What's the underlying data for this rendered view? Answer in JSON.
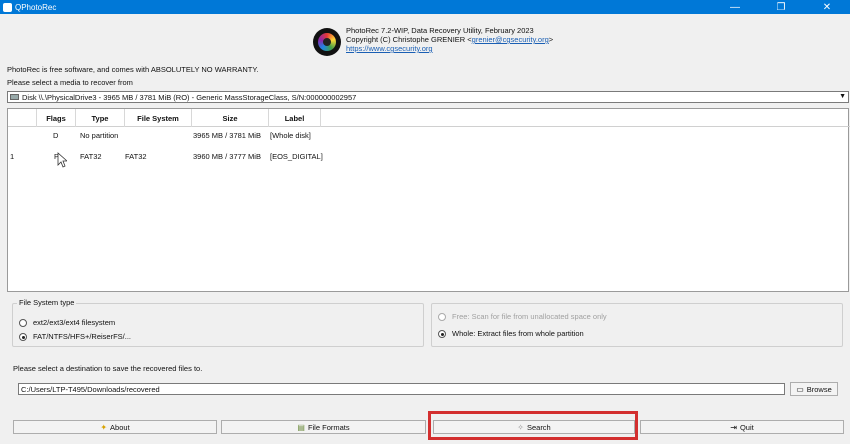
{
  "window": {
    "title": "QPhotoRec",
    "min_glyph": "—",
    "max_glyph": "❐",
    "close_glyph": "✕"
  },
  "header": {
    "line1": "PhotoRec 7.2-WIP, Data Recovery Utility, February 2023",
    "line2_prefix": "Copyright (C) Christophe GRENIER <",
    "email": "grenier@cgsecurity.org",
    "line2_suffix": ">",
    "url": "https://www.cgsecurity.org"
  },
  "warranty": "PhotoRec is free software, and comes with ABSOLUTELY NO WARRANTY.",
  "media_label": "Please select a media to recover from",
  "disk_selected": "Disk \\\\.\\PhysicalDrive3 - 3965 MB / 3781 MiB (RO) - Generic MassStorageClass, S/N:000000002957",
  "table": {
    "headers": [
      "",
      "Flags",
      "Type",
      "File System",
      "Size",
      "Label"
    ],
    "rows": [
      {
        "num": "",
        "flags": "D",
        "type": "No partition",
        "fs": "",
        "size": "3965 MB / 3781 MiB",
        "label": "[Whole disk]"
      },
      {
        "num": "1",
        "flags": "P",
        "type": "FAT32",
        "fs": "FAT32",
        "size": "3960 MB / 3777 MiB",
        "label": "[EOS_DIGITAL]"
      }
    ]
  },
  "fs_type": {
    "legend": "File System type",
    "option1": "ext2/ext3/ext4 filesystem",
    "option2": "FAT/NTFS/HFS+/ReiserFS/..."
  },
  "partition_scope": {
    "option1": "Free: Scan for file from unallocated space only",
    "option2": "Whole: Extract files from whole partition"
  },
  "destination": {
    "label": "Please select a destination to save the recovered files to.",
    "value": "C:/Users/LTP-T495/Downloads/recovered",
    "browse": "Browse"
  },
  "buttons": {
    "about": "About",
    "formats": "File Formats",
    "search": "Search",
    "quit": "Quit"
  },
  "colors": {
    "titlebar": "#0078d7",
    "highlight": "#d32f2f"
  }
}
